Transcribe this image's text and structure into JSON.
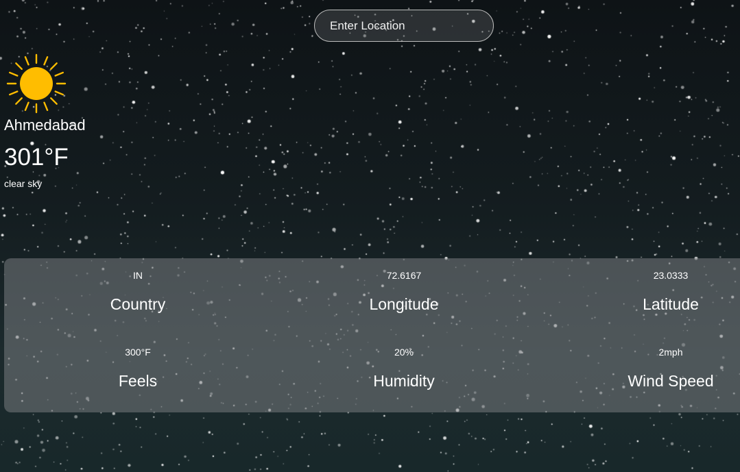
{
  "search": {
    "placeholder": "Enter Location"
  },
  "current": {
    "icon": "sun-icon",
    "city": "Ahmedabad",
    "temperature": "301°F",
    "description": "clear sky"
  },
  "details": [
    {
      "value": "IN",
      "label": "Country"
    },
    {
      "value": "72.6167",
      "label": "Longitude"
    },
    {
      "value": "23.0333",
      "label": "Latitude"
    },
    {
      "value": "300°F",
      "label": "Feels"
    },
    {
      "value": "20%",
      "label": "Humidity"
    },
    {
      "value": "2mph",
      "label": "Wind Speed"
    }
  ],
  "colors": {
    "sun": "#FFBD00",
    "panel": "#787C80",
    "background": "#0E1316"
  }
}
